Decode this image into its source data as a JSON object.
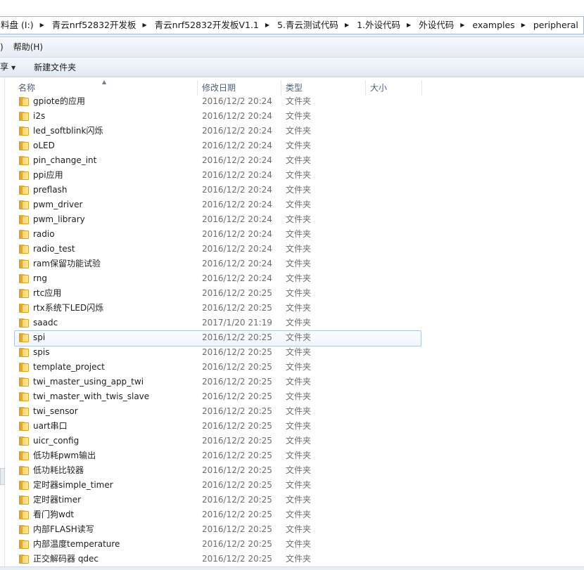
{
  "address": {
    "crumbs": [
      "料盘 (I:)",
      "青云nrf52832开发板",
      "青云nrf52832开发板V1.1",
      "5.青云测试代码",
      "1.外设代码",
      "外设代码",
      "examples",
      "peripheral"
    ],
    "separator": "▶"
  },
  "menubar": {
    "partial_item": ")",
    "help": "帮助(H)"
  },
  "toolbar": {
    "partial_item": "享",
    "new_folder": "新建文件夹"
  },
  "columns": {
    "name": "名称",
    "date": "修改日期",
    "type": "类型",
    "size": "大小"
  },
  "files": [
    {
      "name": "gpiote的应用",
      "date": "2016/12/2 20:24",
      "type": "文件夹"
    },
    {
      "name": "i2s",
      "date": "2016/12/2 20:24",
      "type": "文件夹"
    },
    {
      "name": "led_softblink闪烁",
      "date": "2016/12/2 20:24",
      "type": "文件夹"
    },
    {
      "name": "oLED",
      "date": "2016/12/2 20:24",
      "type": "文件夹"
    },
    {
      "name": "pin_change_int",
      "date": "2016/12/2 20:24",
      "type": "文件夹"
    },
    {
      "name": "ppi应用",
      "date": "2016/12/2 20:24",
      "type": "文件夹"
    },
    {
      "name": "preflash",
      "date": "2016/12/2 20:24",
      "type": "文件夹"
    },
    {
      "name": "pwm_driver",
      "date": "2016/12/2 20:24",
      "type": "文件夹"
    },
    {
      "name": "pwm_library",
      "date": "2016/12/2 20:24",
      "type": "文件夹"
    },
    {
      "name": "radio",
      "date": "2016/12/2 20:24",
      "type": "文件夹"
    },
    {
      "name": "radio_test",
      "date": "2016/12/2 20:24",
      "type": "文件夹"
    },
    {
      "name": "ram保留功能试验",
      "date": "2016/12/2 20:24",
      "type": "文件夹"
    },
    {
      "name": "rng",
      "date": "2016/12/2 20:24",
      "type": "文件夹"
    },
    {
      "name": "rtc应用",
      "date": "2016/12/2 20:25",
      "type": "文件夹"
    },
    {
      "name": "rtx系统下LED闪烁",
      "date": "2016/12/2 20:25",
      "type": "文件夹"
    },
    {
      "name": "saadc",
      "date": "2017/1/20 21:19",
      "type": "文件夹"
    },
    {
      "name": "spi",
      "date": "2016/12/2 20:25",
      "type": "文件夹",
      "selected": true
    },
    {
      "name": "spis",
      "date": "2016/12/2 20:25",
      "type": "文件夹"
    },
    {
      "name": "template_project",
      "date": "2016/12/2 20:25",
      "type": "文件夹"
    },
    {
      "name": "twi_master_using_app_twi",
      "date": "2016/12/2 20:25",
      "type": "文件夹"
    },
    {
      "name": "twi_master_with_twis_slave",
      "date": "2016/12/2 20:25",
      "type": "文件夹"
    },
    {
      "name": "twi_sensor",
      "date": "2016/12/2 20:25",
      "type": "文件夹"
    },
    {
      "name": "uart串口",
      "date": "2016/12/2 20:25",
      "type": "文件夹"
    },
    {
      "name": "uicr_config",
      "date": "2016/12/2 20:25",
      "type": "文件夹"
    },
    {
      "name": "低功耗pwm输出",
      "date": "2016/12/2 20:25",
      "type": "文件夹"
    },
    {
      "name": "低功耗比较器",
      "date": "2016/12/2 20:25",
      "type": "文件夹"
    },
    {
      "name": "定时器simple_timer",
      "date": "2016/12/2 20:25",
      "type": "文件夹"
    },
    {
      "name": "定时器timer",
      "date": "2016/12/2 20:25",
      "type": "文件夹"
    },
    {
      "name": "看门狗wdt",
      "date": "2016/12/2 20:25",
      "type": "文件夹"
    },
    {
      "name": "内部FLASH读写",
      "date": "2016/12/2 20:25",
      "type": "文件夹"
    },
    {
      "name": "内部温度temperature",
      "date": "2016/12/2 20:25",
      "type": "文件夹"
    },
    {
      "name": "正交解码器 qdec",
      "date": "2016/12/2 20:25",
      "type": "文件夹"
    }
  ],
  "icons": {
    "folder": "folder-icon",
    "dropdown": "caret-down-icon",
    "breadcrumb_separator": "chevron-right-icon",
    "sort": "sort-ascending-icon"
  },
  "colors": {
    "selection_border": "#adc6e5",
    "folder_yellow": "#f6d46a",
    "header_text": "#4c607a",
    "secondary_text": "#6d6d6d"
  }
}
